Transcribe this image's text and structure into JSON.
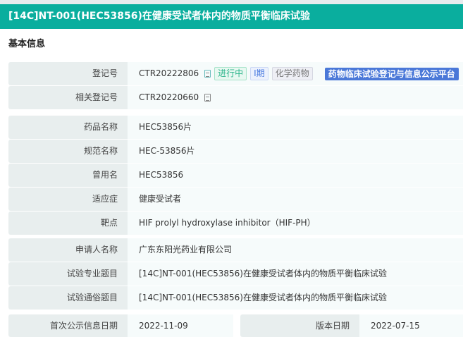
{
  "header": {
    "title": "[14C]NT-001(HEC53856)在健康受试者体内的物质平衡临床试验"
  },
  "section_title": "基本信息",
  "registration": {
    "label": "登记号",
    "value": "CTR20222806",
    "tags": [
      "进行中",
      "I期",
      "化学药物"
    ],
    "platform": "药物临床试验登记与信息公示平台"
  },
  "related": {
    "label": "相关登记号",
    "value": "CTR20220660"
  },
  "drug_rows": [
    {
      "label": "药品名称",
      "value": "HEC53856片"
    },
    {
      "label": "规范名称",
      "value": "HEC-53856片"
    },
    {
      "label": "曾用名",
      "value": "HEC53856"
    },
    {
      "label": "适应症",
      "value": "健康受试者"
    },
    {
      "label": "靶点",
      "value": "HIF prolyl hydroxylase inhibitor（HIF-PH）"
    }
  ],
  "applicant_rows": [
    {
      "label": "申请人名称",
      "value": "广东东阳光药业有限公司"
    },
    {
      "label": "试验专业题目",
      "value": "[14C]NT-001(HEC53856)在健康受试者体内的物质平衡临床试验"
    },
    {
      "label": "试验通俗题目",
      "value": "[14C]NT-001(HEC53856)在健康受试者体内的物质平衡临床试验"
    }
  ],
  "dates": {
    "first_label": "首次公示信息日期",
    "first_value": "2022-11-09",
    "version_label": "版本日期",
    "version_value": "2022-07-15"
  }
}
